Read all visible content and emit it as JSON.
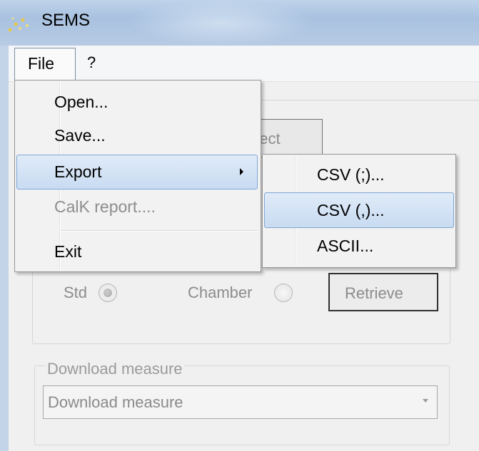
{
  "window": {
    "title": "SEMS"
  },
  "menubar": {
    "file_label": "File",
    "help_label": "?"
  },
  "file_menu": {
    "items": [
      {
        "label": "Open...",
        "enabled": true
      },
      {
        "label": "Save...",
        "enabled": true
      },
      {
        "label": "Export",
        "enabled": true,
        "has_submenu": true,
        "highlighted": true
      },
      {
        "label": "CalK report....",
        "enabled": false
      },
      {
        "label": "Exit",
        "enabled": true
      }
    ]
  },
  "export_submenu": {
    "items": [
      {
        "label": "CSV (;)...",
        "highlighted": false
      },
      {
        "label": "CSV (,)...",
        "highlighted": true
      },
      {
        "label": "ASCII...",
        "highlighted": false
      }
    ]
  },
  "background": {
    "connect_label_partial": "nect",
    "radio_std_label": "Std",
    "radio_chamber_label": "Chamber",
    "retrieve_label": "Retrieve",
    "download_group_label": "Download measure",
    "download_combo_value": "Download measure"
  },
  "colors": {
    "highlight_border": "#7fa6d3",
    "highlight_fill": "#cfe0f4",
    "disabled_text": "#8d8d8d",
    "titlebar": "#b7cbe4"
  },
  "icons": {
    "app_icon": "sparkle-icon",
    "submenu_arrow": "chevron-right-icon",
    "combo_arrow": "chevron-down-icon"
  }
}
